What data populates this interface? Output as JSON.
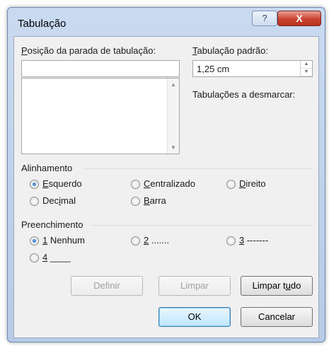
{
  "window": {
    "title": "Tabulação",
    "help_glyph": "?",
    "close_glyph": "X"
  },
  "tab_stop": {
    "label_prefix": "P",
    "label_rest": "osição da parada de tabulação:",
    "value": ""
  },
  "default_tab": {
    "label_prefix": "T",
    "label_rest": "abulação padrão:",
    "value": "1,25 cm"
  },
  "clear_label": "Tabulações a desmarcar:",
  "alignment": {
    "heading": "Alinhamento",
    "options": [
      {
        "key": "E",
        "rest": "squerdo",
        "selected": true
      },
      {
        "key": "C",
        "rest": "entralizado",
        "selected": false
      },
      {
        "key": "D",
        "rest": "ireito",
        "selected": false
      },
      {
        "pre": "Dec",
        "key": "i",
        "rest": "mal",
        "selected": false
      },
      {
        "key": "B",
        "rest": "arra",
        "selected": false
      }
    ]
  },
  "leader": {
    "heading": "Preenchimento",
    "options": [
      {
        "key": "1",
        "rest": " Nenhum",
        "selected": true
      },
      {
        "key": "2",
        "rest": " .......",
        "selected": false
      },
      {
        "key": "3",
        "rest": " -------",
        "selected": false
      },
      {
        "key": "4",
        "rest": " ____",
        "selected": false
      }
    ]
  },
  "buttons": {
    "set": "Definir",
    "clear": "Limpar",
    "clear_all_pre": "Limpar t",
    "clear_all_key": "u",
    "clear_all_post": "do",
    "ok": "OK",
    "cancel": "Cancelar"
  }
}
